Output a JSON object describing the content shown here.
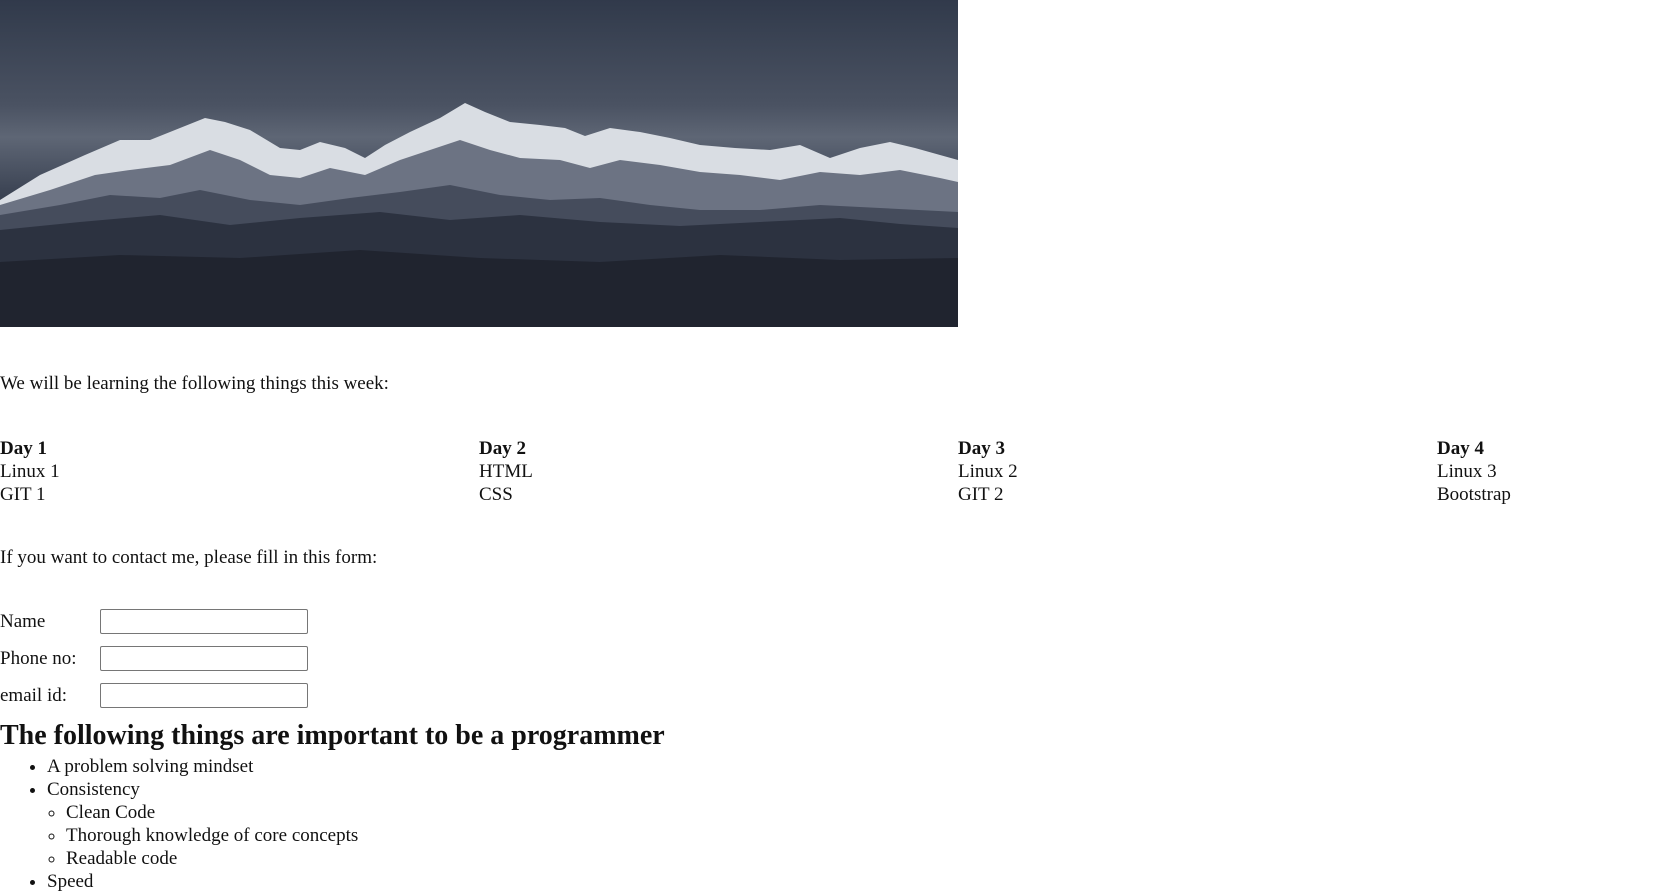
{
  "hero": {
    "image_name": "mountain-range-photo",
    "colors": {
      "sky_top": "#313a4b",
      "sky_glow": "#5e6675",
      "snow": "#e9ebef",
      "rock": "#3b4253",
      "foreground": "#20242f"
    }
  },
  "intro_text": "We will be learning the following things this week:",
  "schedule": [
    {
      "day": "Day 1",
      "items": [
        "Linux 1",
        "GIT 1"
      ]
    },
    {
      "day": "Day 2",
      "items": [
        "HTML",
        "CSS"
      ]
    },
    {
      "day": "Day 3",
      "items": [
        "Linux 2",
        "GIT 2"
      ]
    },
    {
      "day": "Day 4",
      "items": [
        "Linux 3",
        "Bootstrap"
      ]
    }
  ],
  "contact_text": "If you want to contact me, please fill in this form:",
  "form": {
    "name_label": "Name",
    "name_value": "",
    "phone_label": "Phone no:",
    "phone_value": "",
    "email_label": "email id:",
    "email_value": ""
  },
  "programmer": {
    "heading": "The following things are important to be a programmer",
    "items": [
      {
        "label": "A problem solving mindset"
      },
      {
        "label": "Consistency",
        "subitems": [
          "Clean Code",
          "Thorough knowledge of core concepts",
          "Readable code"
        ]
      },
      {
        "label": "Speed"
      }
    ]
  }
}
